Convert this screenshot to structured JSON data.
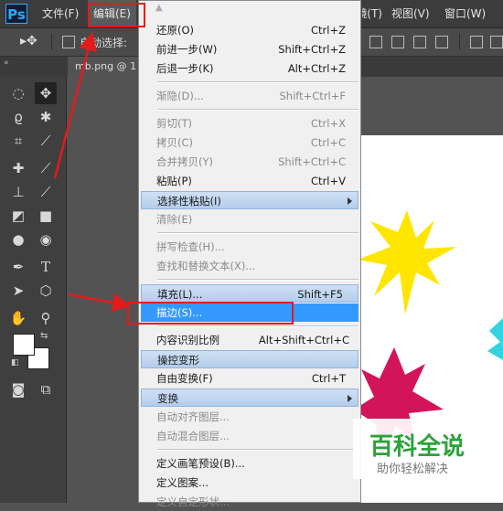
{
  "app": {
    "logo": "Ps"
  },
  "menubar": {
    "items": [
      "文件(F)",
      "编辑(E)",
      "滤镜(T)",
      "视图(V)",
      "窗口(W)"
    ]
  },
  "options_bar": {
    "auto_select_label": "自动选择:"
  },
  "document": {
    "tab_label": "mb.png @ 1"
  },
  "edit_menu": {
    "items": [
      {
        "label": "还原(O)",
        "shortcut": "Ctrl+Z"
      },
      {
        "label": "前进一步(W)",
        "shortcut": "Shift+Ctrl+Z"
      },
      {
        "label": "后退一步(K)",
        "shortcut": "Alt+Ctrl+Z"
      },
      {
        "label": "渐隐(D)...",
        "shortcut": "Shift+Ctrl+F"
      },
      {
        "label": "剪切(T)",
        "shortcut": "Ctrl+X"
      },
      {
        "label": "拷贝(C)",
        "shortcut": "Ctrl+C"
      },
      {
        "label": "合并拷贝(Y)",
        "shortcut": "Shift+Ctrl+C"
      },
      {
        "label": "粘贴(P)",
        "shortcut": "Ctrl+V"
      },
      {
        "label": "选择性粘贴(I)",
        "shortcut": ""
      },
      {
        "label": "清除(E)",
        "shortcut": ""
      },
      {
        "label": "拼写检查(H)...",
        "shortcut": ""
      },
      {
        "label": "查找和替换文本(X)...",
        "shortcut": ""
      },
      {
        "label": "填充(L)...",
        "shortcut": "Shift+F5"
      },
      {
        "label": "描边(S)...",
        "shortcut": ""
      },
      {
        "label": "内容识别比例",
        "shortcut": "Alt+Shift+Ctrl+C"
      },
      {
        "label": "操控变形",
        "shortcut": ""
      },
      {
        "label": "自由变换(F)",
        "shortcut": "Ctrl+T"
      },
      {
        "label": "变换",
        "shortcut": ""
      },
      {
        "label": "自动对齐图层...",
        "shortcut": ""
      },
      {
        "label": "自动混合图层...",
        "shortcut": ""
      },
      {
        "label": "定义画笔预设(B)...",
        "shortcut": ""
      },
      {
        "label": "定义图案...",
        "shortcut": ""
      },
      {
        "label": "定义自定形状...",
        "shortcut": ""
      }
    ]
  },
  "watermark": {
    "title": "百科全说",
    "subtitle": "助你轻松解决"
  },
  "colors": {
    "annotation": "#e41b1b",
    "highlight": "#3399ff",
    "star_yellow": "#ffe600",
    "star_magenta": "#d4145a",
    "star_cyan": "#34d3e0"
  }
}
